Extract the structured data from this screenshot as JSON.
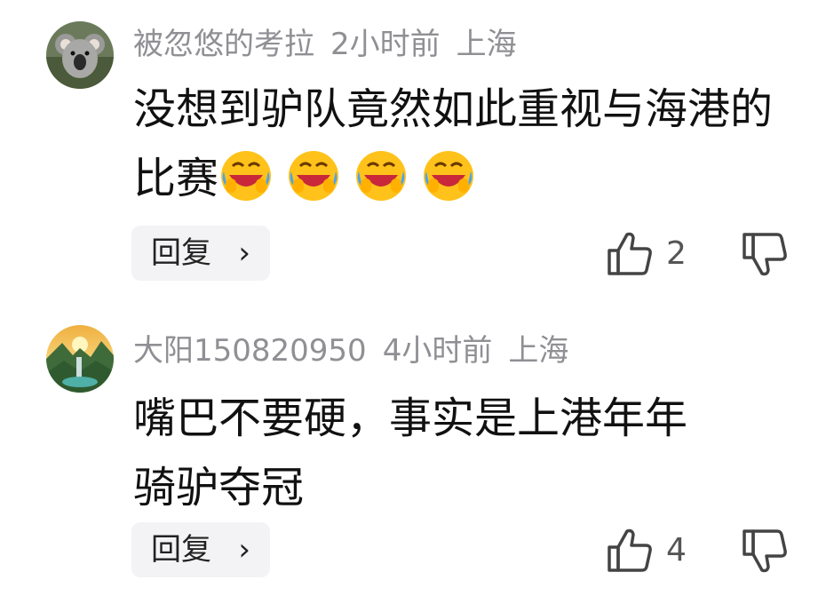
{
  "comments": [
    {
      "username": "被忽悠的考拉",
      "time": "2小时前",
      "location": "上海",
      "text": "没想到驴队竟然如此重视与海港的比赛",
      "emojis": [
        "laughing-crying-emoji",
        "laughing-crying-emoji",
        "laughing-crying-emoji",
        "laughing-crying-emoji"
      ],
      "reply_label": "回复",
      "likes": "2",
      "avatar": "koala-avatar"
    },
    {
      "username": "大阳150820950",
      "time": "4小时前",
      "location": "上海",
      "text_line1": "嘴巴不要硬，事实是上港年年",
      "text_line2": "骑驴夺冠",
      "reply_label": "回复",
      "likes": "4",
      "avatar": "landscape-avatar"
    }
  ],
  "icons": {
    "like": "thumbs-up-icon",
    "dislike": "thumbs-down-icon",
    "chevron": "chevron-right-icon"
  },
  "colors": {
    "meta_text": "#8f8f94",
    "body_text": "#111111",
    "button_bg": "#f3f3f5"
  }
}
